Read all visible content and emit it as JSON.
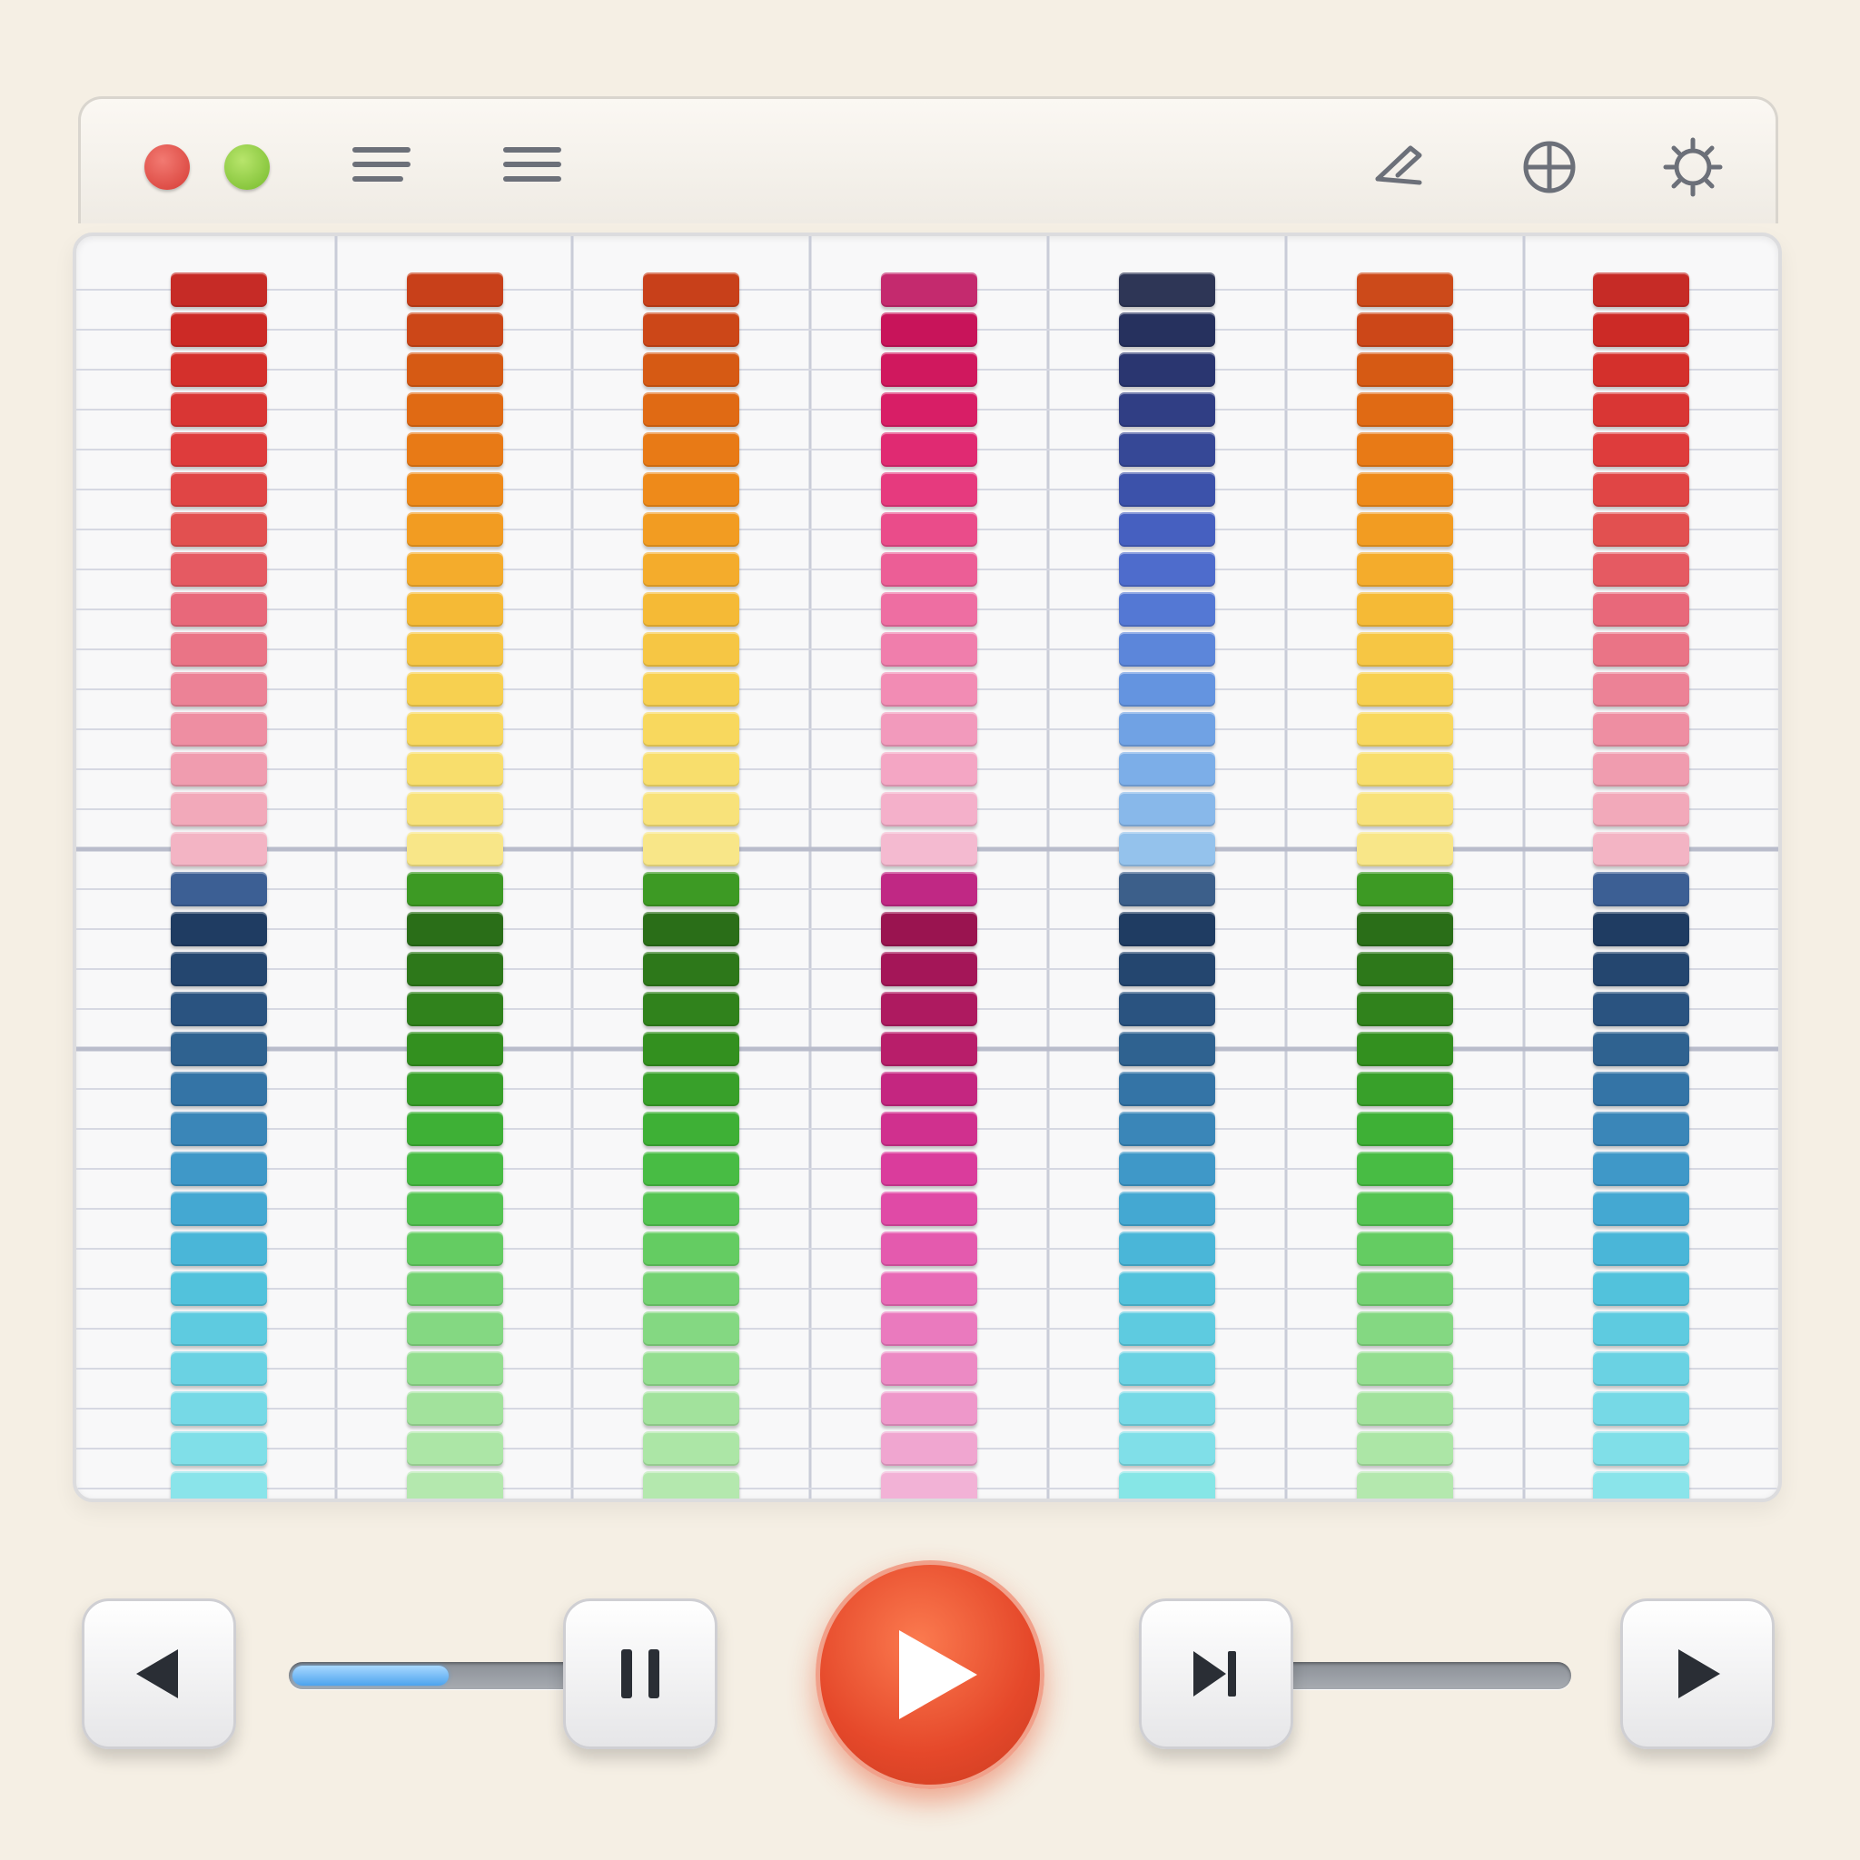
{
  "window": {
    "controls": [
      "close-dot",
      "zoom-dot"
    ],
    "toolbar_icons": [
      "menu-icon",
      "list-icon",
      "pen-icon",
      "crosshair-icon",
      "gear-icon"
    ]
  },
  "mixer": {
    "columns": [
      {
        "name": "red-pink-over-blue-cyan",
        "top": [
          "#c62b26",
          "#cc2a26",
          "#d4302c",
          "#d93634",
          "#de3c3c",
          "#e04545",
          "#e25050",
          "#e55a62",
          "#e8687a",
          "#ea7486",
          "#ec8296",
          "#ee8ea2",
          "#f09caf",
          "#f2a9ba",
          "#f3b4c4"
        ],
        "mid": "#3c5f94",
        "bottom": [
          "#1f3c62",
          "#24466f",
          "#2a5380",
          "#2f6290",
          "#3474a6",
          "#3a86b8",
          "#3f98c8",
          "#44a8d2",
          "#4ab6d8",
          "#52c2dc",
          "#5ecbe0",
          "#6ad2e3",
          "#76d9e6",
          "#80dfe8",
          "#8ae4ea"
        ]
      },
      {
        "name": "orange-yellow-over-green",
        "top": [
          "#c8401a",
          "#cc4718",
          "#d65a14",
          "#e06a14",
          "#e87a16",
          "#ee8a1a",
          "#f29c22",
          "#f4ac2c",
          "#f5ba36",
          "#f6c644",
          "#f7d050",
          "#f8d85e",
          "#f8de6c",
          "#f8e27a",
          "#f8e688"
        ],
        "mid": "#3d9a24",
        "bottom": [
          "#2a6e18",
          "#2d781a",
          "#30821c",
          "#33901f",
          "#38a02a",
          "#3eb036",
          "#48bc44",
          "#54c452",
          "#64cc62",
          "#74d272",
          "#84d882",
          "#94de90",
          "#a2e29c",
          "#ace6a6",
          "#b4e8ae"
        ]
      },
      {
        "name": "orange-yellow-over-green",
        "top": [
          "#c8401a",
          "#cc4718",
          "#d65a14",
          "#e06a14",
          "#e87a16",
          "#ee8a1a",
          "#f29c22",
          "#f4ac2c",
          "#f5ba36",
          "#f6c644",
          "#f7d050",
          "#f8d85e",
          "#f8de6c",
          "#f8e27a",
          "#f8e688"
        ],
        "mid": "#3d9a24",
        "bottom": [
          "#2a6e18",
          "#2d781a",
          "#30821c",
          "#33901f",
          "#38a02a",
          "#3eb036",
          "#48bc44",
          "#54c452",
          "#64cc62",
          "#74d272",
          "#84d882",
          "#94de90",
          "#a2e29c",
          "#ace6a6",
          "#b4e8ae"
        ]
      },
      {
        "name": "magenta-pink-over-magenta",
        "top": [
          "#c42a6e",
          "#c8145a",
          "#d0185e",
          "#d81e66",
          "#e02a72",
          "#e63a7e",
          "#ea4c8a",
          "#ec5e96",
          "#ee6ea2",
          "#f07eac",
          "#f28cb4",
          "#f29abc",
          "#f4a6c4",
          "#f4b0ca",
          "#f4bad0"
        ],
        "mid": "#c02884",
        "bottom": [
          "#9a1450",
          "#a41658",
          "#ae1a60",
          "#b81e6a",
          "#c42680",
          "#d0308e",
          "#da3c9c",
          "#e04aa6",
          "#e45aae",
          "#e86ab6",
          "#ea7abe",
          "#ec8ac4",
          "#ee98ca",
          "#f0a6d0",
          "#f2b2d6"
        ]
      },
      {
        "name": "navy-indigo-over-blue-cyan",
        "top": [
          "#2e3656",
          "#26315e",
          "#2a3670",
          "#303e84",
          "#364896",
          "#3c52aa",
          "#4660c0",
          "#4e6ccc",
          "#5478d4",
          "#5c86da",
          "#6494e0",
          "#70a2e4",
          "#7caee8",
          "#88b8ea",
          "#94c2ec"
        ],
        "mid": "#3c5f8a",
        "bottom": [
          "#1f3c62",
          "#24466f",
          "#2a5380",
          "#2f6290",
          "#3474a6",
          "#3a86b8",
          "#3f98c8",
          "#44a8d2",
          "#4ab6d8",
          "#52c2dc",
          "#5ecbe0",
          "#6ad2e3",
          "#76d9e6",
          "#80dfe8",
          "#86e6e6"
        ]
      },
      {
        "name": "orange-yellow-over-green",
        "top": [
          "#cc4a1a",
          "#cc4718",
          "#d65a14",
          "#e06a14",
          "#e87a16",
          "#ee8a1a",
          "#f29c22",
          "#f4ac2c",
          "#f5ba36",
          "#f6c644",
          "#f7d050",
          "#f8d85e",
          "#f8de6c",
          "#f8e27a",
          "#f8e688"
        ],
        "mid": "#3d9a24",
        "bottom": [
          "#2a6e18",
          "#2d781a",
          "#30821c",
          "#33901f",
          "#38a02a",
          "#3eb036",
          "#48bc44",
          "#54c452",
          "#64cc62",
          "#74d272",
          "#84d882",
          "#94de90",
          "#a2e29c",
          "#ace6a6",
          "#b4e8ae"
        ]
      },
      {
        "name": "red-pink-over-blue-cyan",
        "top": [
          "#c62b26",
          "#cc2a26",
          "#d4302c",
          "#d93634",
          "#de3c3c",
          "#e04545",
          "#e25050",
          "#e55a62",
          "#e8687a",
          "#ea7486",
          "#ec8296",
          "#ee8ea2",
          "#f09caf",
          "#f2a9ba",
          "#f3b4c4"
        ],
        "mid": "#3c5f94",
        "bottom": [
          "#1f3c62",
          "#24466f",
          "#2a5380",
          "#2f6290",
          "#3474a6",
          "#3a86b8",
          "#3f98c8",
          "#44a8d2",
          "#4ab6d8",
          "#52c2dc",
          "#5ecbe0",
          "#6ad2e3",
          "#76d9e6",
          "#80dfe8",
          "#8ae4ea"
        ]
      }
    ]
  },
  "transport": {
    "buttons": [
      "previous-button",
      "pause-button",
      "play-button",
      "skip-next-button",
      "forward-button"
    ],
    "progress_fraction": 0.55,
    "volume_fraction": 0.0,
    "play_color": "#e5482a",
    "progress_color": "#4da3ee"
  }
}
